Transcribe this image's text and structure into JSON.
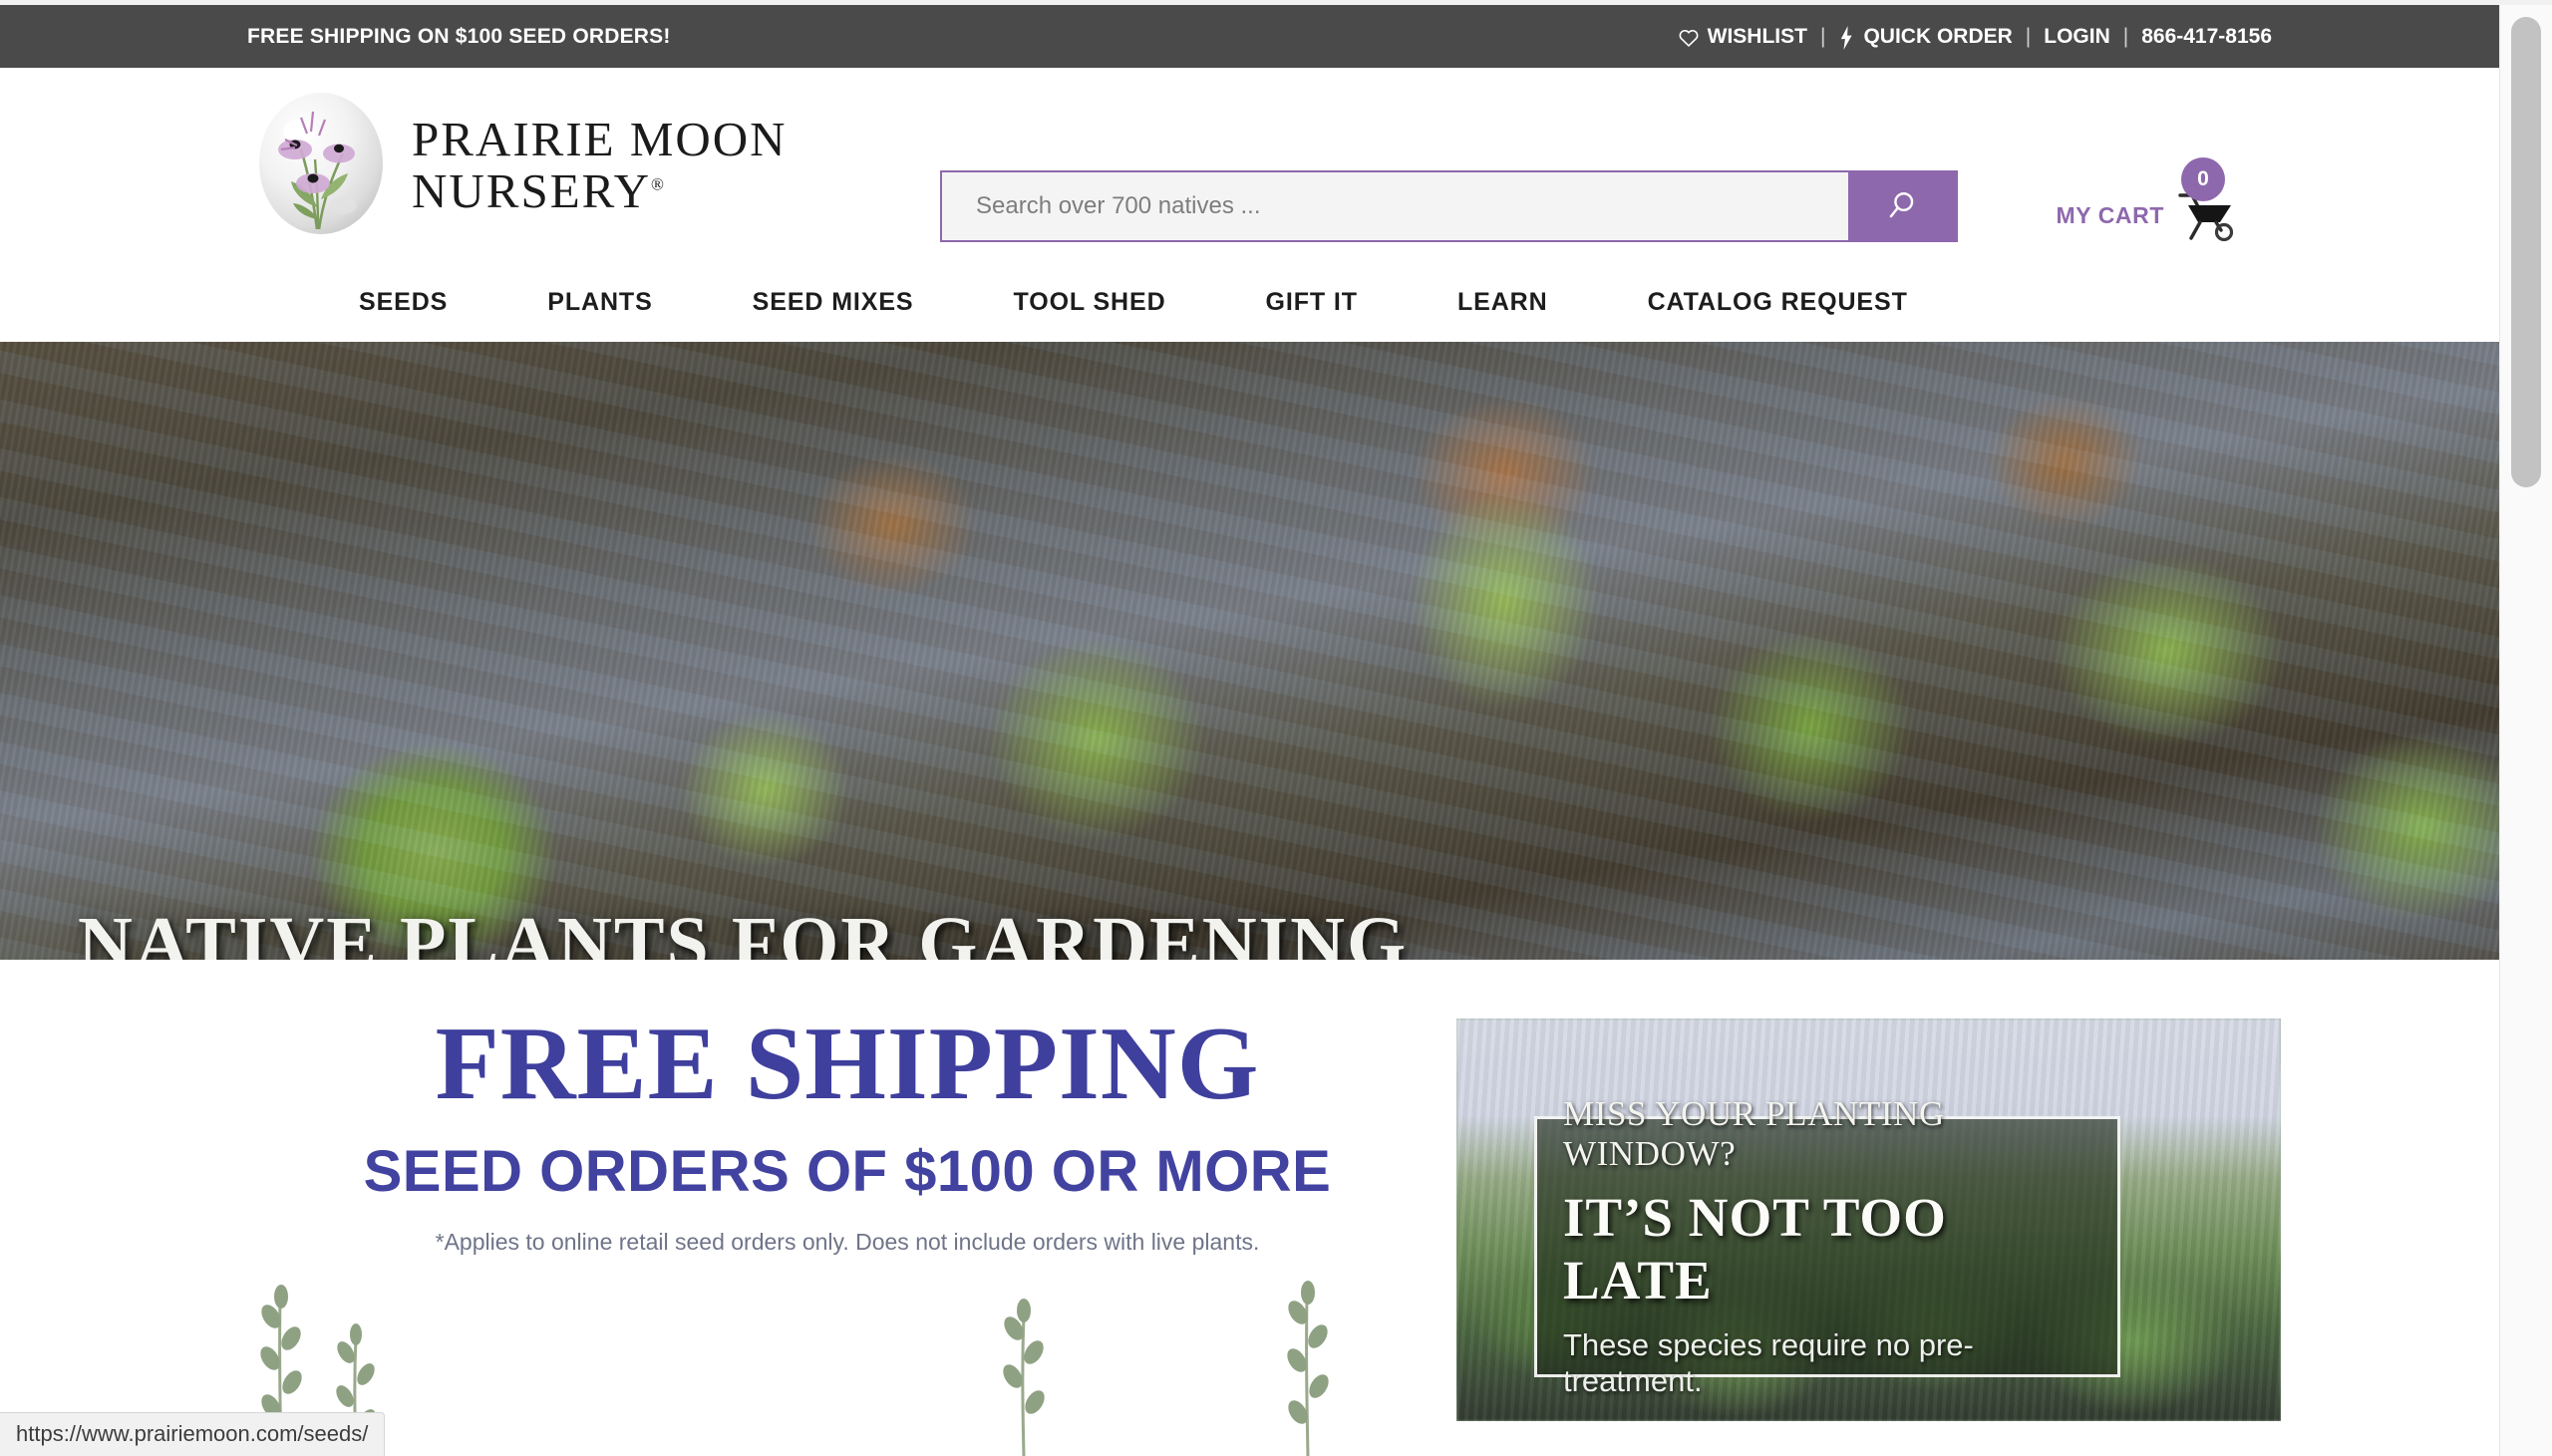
{
  "topbar": {
    "promo": "FREE SHIPPING ON $100 SEED ORDERS!",
    "wishlist": "WISHLIST",
    "wishlist_icon": "heart-icon",
    "quick_order": "QUICK ORDER",
    "quick_order_icon": "lightning-bolt-icon",
    "login": "LOGIN",
    "phone": "866-417-8156",
    "separator": "|",
    "bg_color": "#4a4a4a"
  },
  "header": {
    "logo": {
      "line1": "PRAIRIE MOON",
      "line2": "NURSERY",
      "trademark": "®",
      "icon": "moon-with-coneflowers-logo"
    },
    "search": {
      "placeholder": "Search over 700 natives ...",
      "value": "",
      "button_icon": "search-icon",
      "accent_color": "#8e68ad"
    },
    "cart": {
      "label": "MY CART",
      "count": "0",
      "icon": "wheelbarrow-cart-icon",
      "accent_color": "#8e68ad"
    }
  },
  "nav": {
    "items": [
      {
        "label": "SEEDS"
      },
      {
        "label": "PLANTS"
      },
      {
        "label": "SEED MIXES"
      },
      {
        "label": "TOOL SHED"
      },
      {
        "label": "GIFT IT"
      },
      {
        "label": "LEARN"
      },
      {
        "label": "CATALOG REQUEST"
      }
    ]
  },
  "hero": {
    "headline": "NATIVE PLANTS FOR GARDENING\nAND RESTORATION",
    "image_alt": "seedlings-sprouting-in-nursery-trays"
  },
  "promos": {
    "free_shipping": {
      "title": "FREE SHIPPING",
      "subtitle": "SEED ORDERS OF $100 OR MORE",
      "fine_print": "*Applies to online retail seed orders only. Does not include orders with live plants.",
      "title_color": "#3f3f9e"
    },
    "planting_window": {
      "line1": "MISS YOUR PLANTING WINDOW?",
      "line2": "IT’S NOT TOO LATE",
      "line3": "These species require no pre-treatment.",
      "image_alt": "seedling-flats-in-greenhouse"
    }
  },
  "browser": {
    "status_url": "https://www.prairiemoon.com/seeds/"
  }
}
